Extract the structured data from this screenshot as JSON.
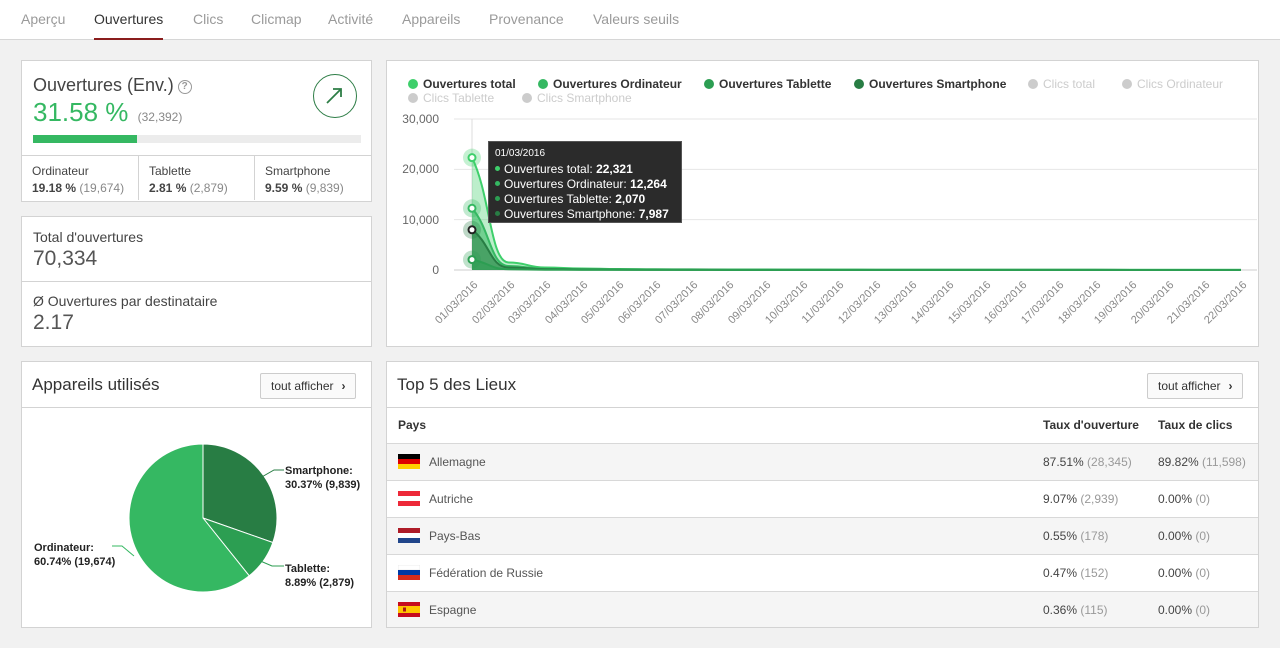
{
  "tabs": [
    {
      "label": "Aperçu"
    },
    {
      "label": "Ouvertures",
      "active": true
    },
    {
      "label": "Clics"
    },
    {
      "label": "Clicmap"
    },
    {
      "label": "Activité"
    },
    {
      "label": "Appareils"
    },
    {
      "label": "Provenance"
    },
    {
      "label": "Valeurs seuils"
    }
  ],
  "opens": {
    "title": "Ouvertures (Env.)",
    "help_icon": "?",
    "rate": "31.58 %",
    "rate_count": "(32,392)",
    "progress": 0.3158,
    "trend_icon": "arrow-up-right-icon",
    "devices": [
      {
        "name": "Ordinateur",
        "rate": "19.18 %",
        "count": "(19,674)"
      },
      {
        "name": "Tablette",
        "rate": "2.81 %",
        "count": "(2,879)"
      },
      {
        "name": "Smartphone",
        "rate": "9.59 %",
        "count": "(9,839)"
      }
    ]
  },
  "totals": {
    "total_label": "Total d'ouvertures",
    "total_value": "70,334",
    "avg_label": "Ø Ouvertures par destinataire",
    "avg_value": "2.17"
  },
  "chart_data": {
    "type": "area",
    "legend": [
      {
        "name": "Ouvertures total",
        "color": "#3ecf6b",
        "active": true
      },
      {
        "name": "Ouvertures Ordinateur",
        "color": "#35b862",
        "active": true
      },
      {
        "name": "Ouvertures Tablette",
        "color": "#2c9e52",
        "active": true
      },
      {
        "name": "Ouvertures Smartphone",
        "color": "#287d44",
        "active": true
      },
      {
        "name": "Clics total",
        "color": "#cccccc",
        "active": false
      },
      {
        "name": "Clics Ordinateur",
        "color": "#cccccc",
        "active": false
      },
      {
        "name": "Clics Tablette",
        "color": "#cccccc",
        "active": false
      },
      {
        "name": "Clics Smartphone",
        "color": "#cccccc",
        "active": false
      }
    ],
    "x": [
      "01/03/2016",
      "02/03/2016",
      "03/03/2016",
      "04/03/2016",
      "05/03/2016",
      "06/03/2016",
      "07/03/2016",
      "08/03/2016",
      "09/03/2016",
      "10/03/2016",
      "11/03/2016",
      "12/03/2016",
      "13/03/2016",
      "14/03/2016",
      "15/03/2016",
      "16/03/2016",
      "17/03/2016",
      "18/03/2016",
      "19/03/2016",
      "20/03/2016",
      "21/03/2016",
      "22/03/2016"
    ],
    "yticks": [
      "30,000",
      "20,000",
      "10,000",
      "0"
    ],
    "ylim": [
      0,
      30000
    ],
    "series": [
      {
        "name": "Ouvertures total",
        "color": "#3ecf6b",
        "values": [
          22321,
          1500,
          500,
          300,
          200,
          150,
          120,
          100,
          90,
          80,
          70,
          60,
          60,
          50,
          50,
          40,
          40,
          40,
          30,
          30,
          30,
          30
        ]
      },
      {
        "name": "Ouvertures Ordinateur",
        "color": "#35b862",
        "values": [
          12264,
          800,
          250,
          150,
          100,
          80,
          60,
          50,
          45,
          40,
          35,
          30,
          30,
          25,
          25,
          20,
          20,
          20,
          15,
          15,
          15,
          15
        ]
      },
      {
        "name": "Ouvertures Smartphone",
        "color": "#287d44",
        "values": [
          7987,
          500,
          180,
          110,
          70,
          50,
          40,
          35,
          30,
          30,
          25,
          20,
          20,
          18,
          18,
          15,
          15,
          15,
          12,
          12,
          12,
          12
        ]
      },
      {
        "name": "Ouvertures Tablette",
        "color": "#2c9e52",
        "values": [
          2070,
          150,
          60,
          35,
          25,
          20,
          15,
          12,
          10,
          10,
          8,
          8,
          8,
          6,
          6,
          5,
          5,
          5,
          4,
          4,
          4,
          4
        ]
      }
    ],
    "tooltip": {
      "date": "01/03/2016",
      "lines": [
        {
          "label": "Ouvertures total:",
          "value": "22,321"
        },
        {
          "label": "Ouvertures Ordinateur:",
          "value": "12,264"
        },
        {
          "label": "Ouvertures Tablette:",
          "value": "2,070"
        },
        {
          "label": "Ouvertures Smartphone:",
          "value": "7,987"
        }
      ]
    }
  },
  "devices_panel": {
    "title": "Appareils utilisés",
    "button": "tout afficher",
    "pie": [
      {
        "name": "Ordinateur",
        "pct": 60.74,
        "label": "Ordinateur:",
        "sub": "60.74% (19,674)",
        "color": "#35b862"
      },
      {
        "name": "Smartphone",
        "pct": 30.37,
        "label": "Smartphone:",
        "sub": "30.37% (9,839)",
        "color": "#287d44"
      },
      {
        "name": "Tablette",
        "pct": 8.89,
        "label": "Tablette:",
        "sub": "8.89% (2,879)",
        "color": "#2c9e52"
      }
    ]
  },
  "places": {
    "title": "Top 5 des Lieux",
    "button": "tout afficher",
    "headers": {
      "country": "Pays",
      "open": "Taux d'ouverture",
      "click": "Taux de clics"
    },
    "rows": [
      {
        "flag": "de",
        "country": "Allemagne",
        "open": "87.51%",
        "open_n": "(28,345)",
        "click": "89.82%",
        "click_n": "(11,598)"
      },
      {
        "flag": "at",
        "country": "Autriche",
        "open": "9.07%",
        "open_n": "(2,939)",
        "click": "0.00%",
        "click_n": "(0)"
      },
      {
        "flag": "nl",
        "country": "Pays-Bas",
        "open": "0.55%",
        "open_n": "(178)",
        "click": "0.00%",
        "click_n": "(0)"
      },
      {
        "flag": "ru",
        "country": "Fédération de Russie",
        "open": "0.47%",
        "open_n": "(152)",
        "click": "0.00%",
        "click_n": "(0)"
      },
      {
        "flag": "es",
        "country": "Espagne",
        "open": "0.36%",
        "open_n": "(115)",
        "click": "0.00%",
        "click_n": "(0)"
      }
    ]
  }
}
